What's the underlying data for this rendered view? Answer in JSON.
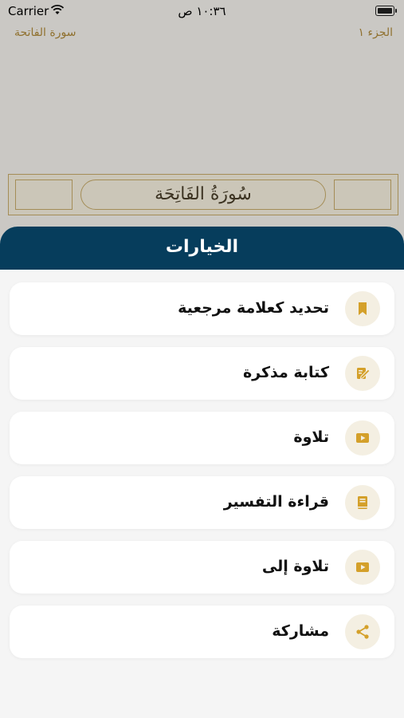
{
  "status_bar": {
    "carrier": "Carrier",
    "time": "١٠:٣٦ ص"
  },
  "page": {
    "surah_header": "سورة الفاتحة",
    "juz_label": "الجزء ١",
    "banner_title": "سُورَةُ الفَاتِحَة"
  },
  "sheet": {
    "title": "الخيارات",
    "options": [
      {
        "label": "تحديد كعلامة مرجعية",
        "icon": "bookmark-icon"
      },
      {
        "label": "كتابة مذكرة",
        "icon": "note-edit-icon"
      },
      {
        "label": "تلاوة",
        "icon": "play-icon"
      },
      {
        "label": "قراءة التفسير",
        "icon": "book-icon"
      },
      {
        "label": "تلاوة إلى",
        "icon": "play-icon"
      },
      {
        "label": "مشاركة",
        "icon": "share-icon"
      }
    ]
  },
  "colors": {
    "header_bg": "#063d5c",
    "accent_gold": "#d4a02a",
    "icon_circle": "#f4efe2"
  }
}
